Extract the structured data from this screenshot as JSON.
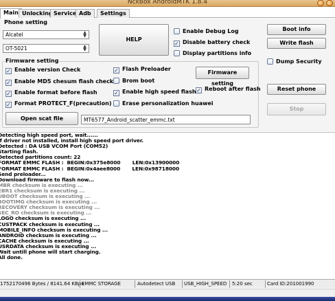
{
  "window": {
    "title": "NckBox AndroidMTK 1.8.4"
  },
  "tabs": [
    "Main",
    "Unlocking",
    "Service",
    "Adb",
    "Settings"
  ],
  "phone_setting": {
    "title": "Phone setting",
    "brand": "Alcatel",
    "model": "OT-5021"
  },
  "buttons": {
    "help": "HELP",
    "boot_info": "Boot info",
    "write_flash": "Write flash",
    "firmware_setting": "Firmware setting",
    "reset_phone": "Reset phone",
    "stop": "Stop",
    "open_scat": "Open scat file"
  },
  "options": {
    "enable_debug_log": {
      "label": "Enable Debug Log",
      "checked": false
    },
    "disable_battery_check": {
      "label": "Disable battery check",
      "checked": true
    },
    "display_partitions_info": {
      "label": "Display partitions info",
      "checked": false
    },
    "dump_security": {
      "label": "Dump Security",
      "checked": false
    },
    "reboot_after_flash": {
      "label": "Reboot after flash",
      "checked": true
    }
  },
  "firmware": {
    "title": "Firmware setting",
    "enable_version_check": {
      "label": "Enable version Check",
      "checked": true
    },
    "enable_md5": {
      "label": "Enable MD5 chesum flash check",
      "checked": true
    },
    "enable_format": {
      "label": "Enable format before flash",
      "checked": true
    },
    "format_protect": {
      "label": "Format PROTECT_F(precaution)",
      "checked": true
    },
    "flash_preloader": {
      "label": "Flash Preloader",
      "checked": true
    },
    "brom_boot": {
      "label": "Brom boot",
      "checked": false
    },
    "enable_high_speed": {
      "label": "Enable high speed flash",
      "checked": true
    },
    "erase_personalization": {
      "label": "Erase personalization huawei",
      "checked": false
    },
    "scatter_file": "MT6577_Android_scatter_emmc.txt"
  },
  "log": [
    {
      "text": "Detecting high speed port, wait......",
      "faded": false
    },
    {
      "text": "If driver not installed, install high speed port driver.",
      "faded": false
    },
    {
      "text": "Detected : DA USB VCOM Port (COM52)",
      "faded": false
    },
    {
      "text": "Starting flash.",
      "faded": false
    },
    {
      "text": "Detected partitions count: 22",
      "faded": false
    },
    {
      "text": "FORMAT EMMC FLASH :  BEGIN:0x375e8000       LEN:0x13900000",
      "faded": false
    },
    {
      "text": "FORMAT EMMC FLASH :  BEGIN:0x4aee8000       LEN:0x98718000",
      "faded": false
    },
    {
      "text": "Send preloader...",
      "faded": false
    },
    {
      "text": "Download firmware to flash now...",
      "faded": false
    },
    {
      "text": "MBR checksum is executing ...",
      "faded": true
    },
    {
      "text": "EBR1 checksum is executing ...",
      "faded": true
    },
    {
      "text": "UBOOT checksum is executing ...",
      "faded": true
    },
    {
      "text": "BOOTIMG checksum is executing ...",
      "faded": true
    },
    {
      "text": "RECOVERY checksum is executing ...",
      "faded": true
    },
    {
      "text": "SEC_RO checksum is executing ...",
      "faded": true
    },
    {
      "text": "LOGO checksum is executing ...",
      "faded": false
    },
    {
      "text": "CUSTPACK checksum is executing ...",
      "faded": false
    },
    {
      "text": "MOBILE_INFO checksum is executing ...",
      "faded": false
    },
    {
      "text": "ANDROID checksum is executing ...",
      "faded": false
    },
    {
      "text": "CACHE checksum is executing ...",
      "faded": false
    },
    {
      "text": "USRDATA checksum is executing ...",
      "faded": false
    },
    {
      "text": "Wait untill phone will start charging.",
      "faded": false
    },
    {
      "text": "All done.",
      "faded": false
    }
  ],
  "status": {
    "bytes": "1752170496 Bytes / 8141.64 KBps",
    "storage": "EMMC STORAGE",
    "detect": "Autodetect USB",
    "speed": "USB_HIGH_SPEED",
    "time": "5:20 sec",
    "card": "Card ID:201001990"
  },
  "colors": {
    "title_bar": "#d9a760",
    "taskbar": "#1c2a70"
  }
}
